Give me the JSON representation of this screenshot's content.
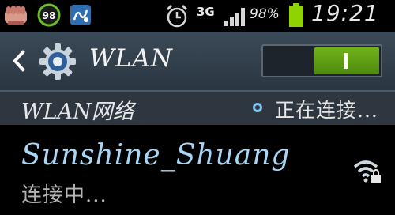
{
  "status_bar": {
    "notification_icons": [
      "fist-icon",
      "badge-98-icon",
      "app-icon"
    ],
    "badge_number": "98",
    "alarm_icon": "alarm-clock-icon",
    "network_type": "3G",
    "signal_icon": "signal-strength-icon",
    "battery_percent": "98%",
    "battery_icon": "battery-icon",
    "time": "19:21"
  },
  "action_bar": {
    "back_icon": "chevron-left-icon",
    "settings_icon": "gear-icon",
    "title": "WLAN",
    "toggle_state": "on"
  },
  "section": {
    "title": "WLAN网络",
    "scan_icon": "scanning-indicator-icon",
    "scan_status": "正在连接..."
  },
  "networks": [
    {
      "name": "Sunshine_Shuang",
      "status": "连接中...",
      "icon": "wifi-locked-icon"
    }
  ],
  "colors": {
    "action_bar": "#2a3642",
    "toggle_on": "#5f9c14",
    "network_name": "#a9d6f4",
    "battery": "#8fd400"
  }
}
